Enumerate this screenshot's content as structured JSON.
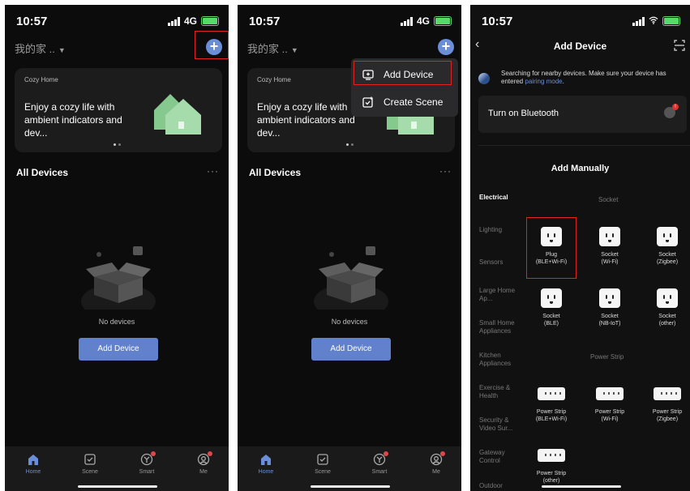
{
  "status": {
    "time": "10:57",
    "carrier": "4G"
  },
  "home": {
    "title": "我的家 ..",
    "banner_small": "Cozy Home",
    "banner_big": "Enjoy a cozy life with ambient indicators and dev...",
    "all_devices": "All Devices",
    "more": "···",
    "no_devices": "No devices",
    "add_device_btn": "Add Device"
  },
  "tabs": [
    {
      "label": "Home"
    },
    {
      "label": "Scene"
    },
    {
      "label": "Smart"
    },
    {
      "label": "Me"
    }
  ],
  "dropdown": {
    "add_device": "Add Device",
    "create_scene": "Create Scene"
  },
  "add_device_screen": {
    "title": "Add Device",
    "search_text": "Searching for nearby devices. Make sure your device has entered",
    "search_link": "pairing mode",
    "search_end": ".",
    "bluetooth": "Turn on Bluetooth",
    "bt_badge": "!",
    "add_manually": "Add Manually",
    "categories": [
      "Electrical",
      "Lighting",
      "Sensors",
      "Large Home Ap...",
      "Small Home Appliances",
      "Kitchen Appliances",
      "Exercise & Health",
      "Security & Video Sur...",
      "Gateway Control",
      "Outdoor"
    ],
    "section_socket": "Socket",
    "section_strip": "Power Strip",
    "sockets": [
      {
        "line1": "Plug",
        "line2": "(BLE+Wi-Fi)"
      },
      {
        "line1": "Socket",
        "line2": "(Wi-Fi)"
      },
      {
        "line1": "Socket",
        "line2": "(Zigbee)"
      },
      {
        "line1": "Socket",
        "line2": "(BLE)"
      },
      {
        "line1": "Socket",
        "line2": "(NB-IoT)"
      },
      {
        "line1": "Socket",
        "line2": "(other)"
      }
    ],
    "strips": [
      {
        "line1": "Power Strip",
        "line2": "(BLE+Wi-Fi)"
      },
      {
        "line1": "Power Strip",
        "line2": "(Wi-Fi)"
      },
      {
        "line1": "Power Strip",
        "line2": "(Zigbee)"
      },
      {
        "line1": "Power Strip",
        "line2": "(other)"
      }
    ]
  },
  "colors": {
    "accent": "#6a8fd8",
    "highlight": "#e02424",
    "background": "#0c0c0c"
  }
}
